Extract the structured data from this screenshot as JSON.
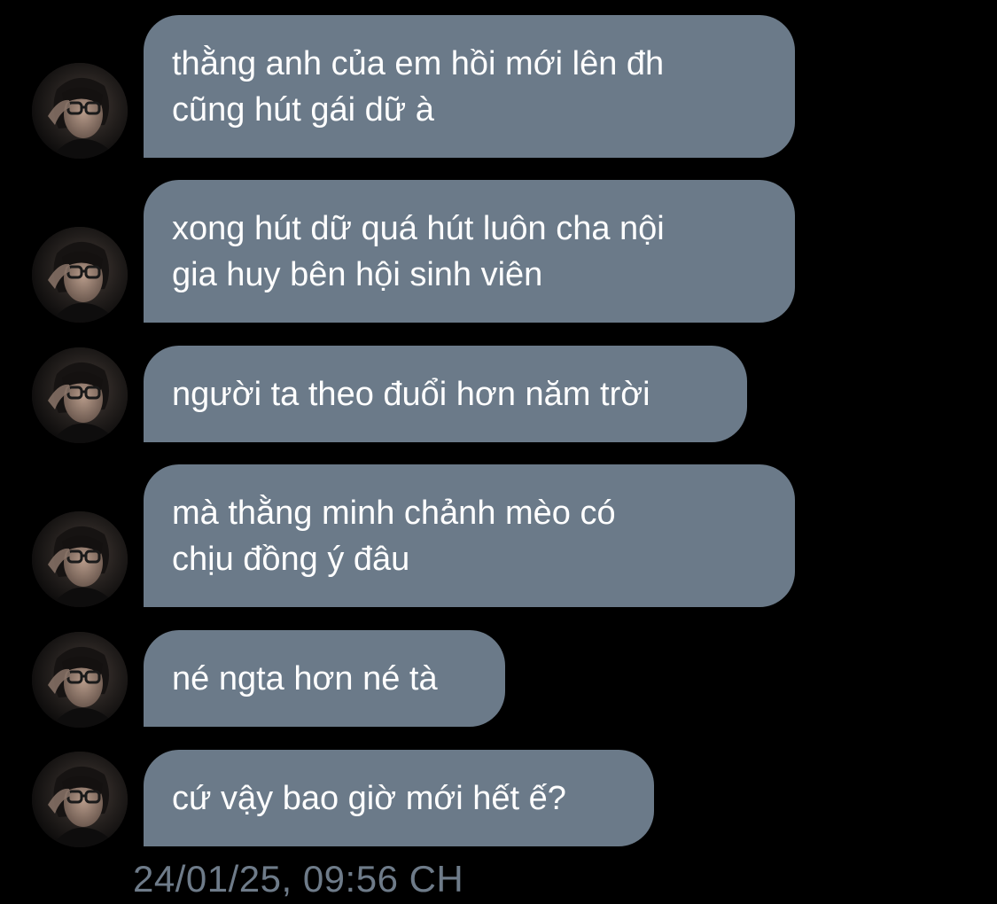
{
  "messages": [
    {
      "text": "thằng anh của em hồi mới lên đh\ncũng hút gái dữ à"
    },
    {
      "text": "xong hút dữ quá hút luôn cha nội\ngia huy bên hội sinh viên"
    },
    {
      "text": "người ta theo đuổi hơn năm trời"
    },
    {
      "text": "mà thằng minh chảnh mèo có\nchịu đồng ý đâu"
    },
    {
      "text": "né ngta hơn né tà"
    },
    {
      "text": "cứ vậy bao giờ mới hết ế?"
    }
  ],
  "timestamp": "24/01/25, 09:56 CH",
  "colors": {
    "background": "#000000",
    "bubble": "#6b7a89",
    "bubble_text": "#ffffff",
    "timestamp": "#6e7b89"
  },
  "icons": {
    "avatar": "contact-photo"
  }
}
